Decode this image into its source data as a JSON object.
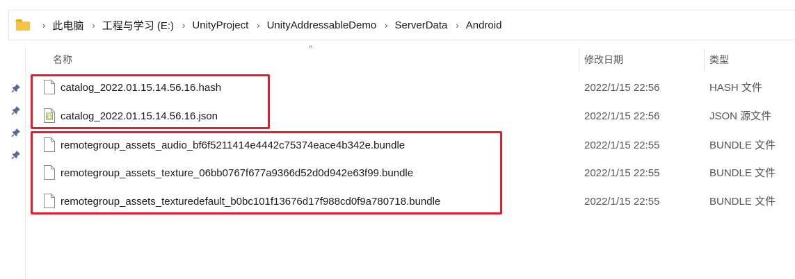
{
  "breadcrumb": {
    "items": [
      "此电脑",
      "工程与学习 (E:)",
      "UnityProject",
      "UnityAddressableDemo",
      "ServerData",
      "Android"
    ],
    "separator": "›"
  },
  "columns": {
    "name": "名称",
    "date": "修改日期",
    "type": "类型",
    "sort_indicator": "^"
  },
  "files": [
    {
      "name": "catalog_2022.01.15.14.56.16.hash",
      "date": "2022/1/15 22:56",
      "type": "HASH 文件",
      "icon": "blank-file-icon"
    },
    {
      "name": "catalog_2022.01.15.14.56.16.json",
      "date": "2022/1/15 22:56",
      "type": "JSON 源文件",
      "icon": "json-file-icon"
    },
    {
      "name": "remotegroup_assets_audio_bf6f5211414e4442c75374eace4b342e.bundle",
      "date": "2022/1/15 22:55",
      "type": "BUNDLE 文件",
      "icon": "blank-file-icon"
    },
    {
      "name": "remotegroup_assets_texture_06bb0767f677a9366d52d0d942e63f99.bundle",
      "date": "2022/1/15 22:55",
      "type": "BUNDLE 文件",
      "icon": "blank-file-icon"
    },
    {
      "name": "remotegroup_assets_texturedefault_b0bc101f13676d17f988cd0f9a780718.bundle",
      "date": "2022/1/15 22:55",
      "type": "BUNDLE 文件",
      "icon": "blank-file-icon"
    }
  ],
  "quick_access_pins": [
    "pin-icon",
    "pin-icon",
    "pin-icon",
    "pin-icon"
  ],
  "colors": {
    "highlight": "#e81c2c",
    "folder": "#f6c342",
    "json_icon_accent": "#8cb43c"
  }
}
